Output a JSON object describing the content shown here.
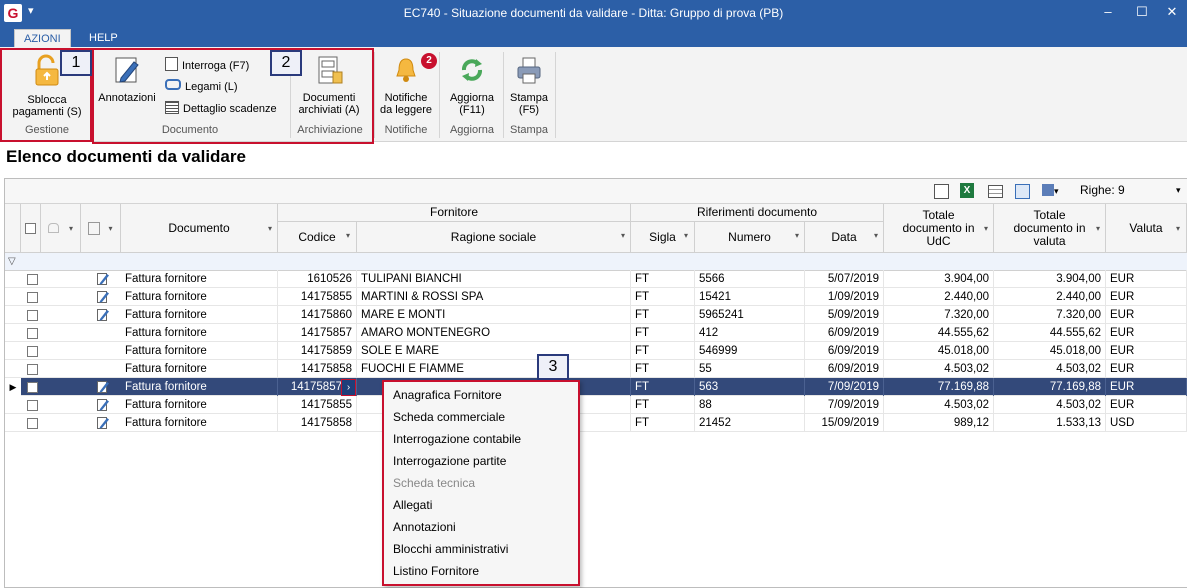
{
  "window": {
    "title": "EC740 - Situazione documenti da validare - Ditta: Gruppo di prova (PB)",
    "app_icon": "G",
    "qat_glyph": "▾",
    "minimize": "–",
    "maximize": "☐",
    "close": "✕"
  },
  "menu": {
    "tabs": [
      {
        "label": "AZIONI"
      },
      {
        "label": "HELP"
      }
    ]
  },
  "ribbon": {
    "gestione": {
      "button": "Sbloccapagamenti (S)",
      "button_line1": "Sblocca",
      "button_line2": "pagamenti (S)",
      "label": "Gestione"
    },
    "documento": {
      "annotazioni": "Annotazioni",
      "interroga": "Interroga (F7)",
      "legami": "Legami (L)",
      "dettaglio": "Dettaglio scadenze",
      "label": "Documento"
    },
    "archiviazione": {
      "line1": "Documenti",
      "line2": "archiviati (A)",
      "label": "Archiviazione"
    },
    "notifiche": {
      "line1": "Notifiche",
      "line2": "da leggere",
      "label": "Notifiche",
      "badge": "2"
    },
    "aggiorna": {
      "line1": "Aggiorna",
      "line2": "(F11)",
      "label": "Aggiorna"
    },
    "stampa": {
      "line1": "Stampa",
      "line2": "(F5)",
      "label": "Stampa"
    }
  },
  "callouts": [
    "1",
    "2",
    "3"
  ],
  "heading": "Elenco documenti da validare",
  "grid": {
    "toolbar": {
      "righe_label": "Righe: 9"
    },
    "group_headers": {
      "fornitore": "Fornitore",
      "riferimenti": "Riferimenti documento"
    },
    "columns": {
      "documento": "Documento",
      "codice": "Codice",
      "ragione": "Ragione sociale",
      "sigla": "Sigla",
      "numero": "Numero",
      "data": "Data",
      "tot_udc": "Totale documento in UdC",
      "tot_valuta": "Totale documento in valuta",
      "valuta": "Valuta"
    },
    "rows": [
      {
        "doc": "Fattura fornitore",
        "codice": "1610526",
        "ragione": "TULIPANI BIANCHI",
        "sigla": "FT",
        "numero": "5566",
        "data": "5/07/2019",
        "tot_udc": "3.904,00",
        "tot_valuta": "3.904,00",
        "valuta": "EUR",
        "pen": true
      },
      {
        "doc": "Fattura fornitore",
        "codice": "14175855",
        "ragione": "MARTINI & ROSSI SPA",
        "sigla": "FT",
        "numero": "15421",
        "data": "1/09/2019",
        "tot_udc": "2.440,00",
        "tot_valuta": "2.440,00",
        "valuta": "EUR",
        "pen": true
      },
      {
        "doc": "Fattura fornitore",
        "codice": "14175860",
        "ragione": "MARE E MONTI",
        "sigla": "FT",
        "numero": "5965241",
        "data": "5/09/2019",
        "tot_udc": "7.320,00",
        "tot_valuta": "7.320,00",
        "valuta": "EUR",
        "pen": true
      },
      {
        "doc": "Fattura fornitore",
        "codice": "14175857",
        "ragione": "AMARO MONTENEGRO",
        "sigla": "FT",
        "numero": "412",
        "data": "6/09/2019",
        "tot_udc": "44.555,62",
        "tot_valuta": "44.555,62",
        "valuta": "EUR",
        "pen": false
      },
      {
        "doc": "Fattura fornitore",
        "codice": "14175859",
        "ragione": "SOLE E MARE",
        "sigla": "FT",
        "numero": "546999",
        "data": "6/09/2019",
        "tot_udc": "45.018,00",
        "tot_valuta": "45.018,00",
        "valuta": "EUR",
        "pen": false
      },
      {
        "doc": "Fattura fornitore",
        "codice": "14175858",
        "ragione": "FUOCHI E FIAMME",
        "sigla": "FT",
        "numero": "55",
        "data": "6/09/2019",
        "tot_udc": "4.503,02",
        "tot_valuta": "4.503,02",
        "valuta": "EUR",
        "pen": false
      },
      {
        "doc": "Fattura fornitore",
        "codice": "14175857",
        "ragione": "",
        "sigla": "FT",
        "numero": "563",
        "data": "7/09/2019",
        "tot_udc": "77.169,88",
        "tot_valuta": "77.169,88",
        "valuta": "EUR",
        "pen": true
      },
      {
        "doc": "Fattura fornitore",
        "codice": "14175855",
        "ragione": "",
        "sigla": "FT",
        "numero": "88",
        "data": "7/09/2019",
        "tot_udc": "4.503,02",
        "tot_valuta": "4.503,02",
        "valuta": "EUR",
        "pen": true
      },
      {
        "doc": "Fattura fornitore",
        "codice": "14175858",
        "ragione": "",
        "sigla": "FT",
        "numero": "21452",
        "data": "15/09/2019",
        "tot_udc": "989,12",
        "tot_valuta": "1.533,13",
        "valuta": "USD",
        "pen": true
      }
    ]
  },
  "context_menu": {
    "items": [
      {
        "label": "Anagrafica Fornitore",
        "enabled": true
      },
      {
        "label": "Scheda commerciale",
        "enabled": true
      },
      {
        "label": "Interrogazione contabile",
        "enabled": true
      },
      {
        "label": "Interrogazione partite",
        "enabled": true
      },
      {
        "label": "Scheda tecnica",
        "enabled": false
      },
      {
        "label": "Allegati",
        "enabled": true
      },
      {
        "label": "Annotazioni",
        "enabled": true
      },
      {
        "label": "Blocchi amministrativi",
        "enabled": true
      },
      {
        "label": "Listino Fornitore",
        "enabled": true
      }
    ]
  },
  "colors": {
    "titlebar": "#2c5fa7",
    "selected_row": "#33497a",
    "callout_red": "#c8102e",
    "callout_blue": "#2a3a7c"
  }
}
